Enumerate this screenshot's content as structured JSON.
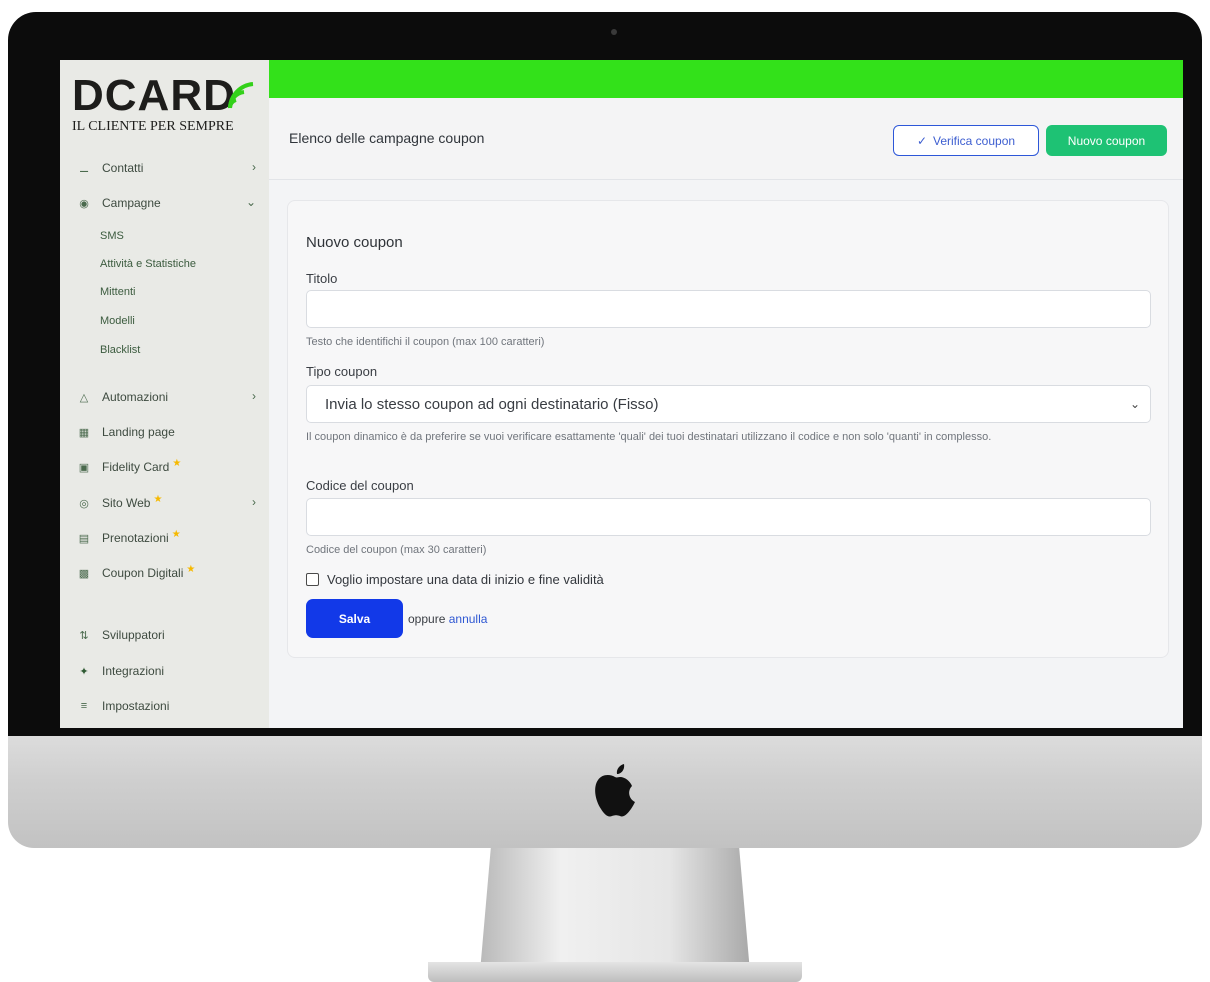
{
  "brand": {
    "logo_word": "DCARD",
    "tagline": "IL CLIENTE PER SEMPRE",
    "accent_green": "#33e11a"
  },
  "sidebar": {
    "items": [
      {
        "label": "Contatti",
        "icon": "contacts-icon",
        "has_chevron": "right"
      },
      {
        "label": "Campagne",
        "icon": "campaign-icon",
        "has_chevron": "down"
      },
      {
        "label": "Automazioni",
        "icon": "automation-icon",
        "has_chevron": "right"
      },
      {
        "label": "Landing page",
        "icon": "landing-page-icon"
      },
      {
        "label": "Fidelity Card",
        "icon": "card-icon",
        "starred": true
      },
      {
        "label": "Sito Web",
        "icon": "globe-icon",
        "starred": true,
        "has_chevron": "right"
      },
      {
        "label": "Prenotazioni",
        "icon": "calendar-icon",
        "starred": true
      },
      {
        "label": "Coupon Digitali",
        "icon": "coupon-icon",
        "starred": true
      },
      {
        "label": "Sviluppatori",
        "icon": "developer-icon"
      },
      {
        "label": "Integrazioni",
        "icon": "puzzle-icon"
      },
      {
        "label": "Impostazioni",
        "icon": "settings-icon"
      }
    ],
    "campaign_sub": [
      "SMS",
      "Attività e Statistiche",
      "Mittenti",
      "Modelli",
      "Blacklist"
    ]
  },
  "header": {
    "title": "Elenco delle campagne coupon",
    "verify_label": "Verifica coupon",
    "new_label": "Nuovo coupon"
  },
  "form": {
    "title": "Nuovo coupon",
    "title_label": "Titolo",
    "title_value": "",
    "title_help": "Testo che identifichi il coupon (max 100 caratteri)",
    "type_label": "Tipo coupon",
    "type_value": "Invia lo stesso coupon ad ogni destinatario (Fisso)",
    "type_help": "Il coupon dinamico è da preferire se vuoi verificare esattamente 'quali' dei tuoi destinatari utilizzano il codice e non solo 'quanti' in complesso.",
    "code_label": "Codice del coupon",
    "code_value": "",
    "code_help": "Codice del coupon (max 30 caratteri)",
    "validity_label": "Voglio impostare una data di inizio e fine validità",
    "validity_checked": false,
    "save_label": "Salva",
    "or_text": "oppure",
    "cancel_label": "annulla"
  }
}
